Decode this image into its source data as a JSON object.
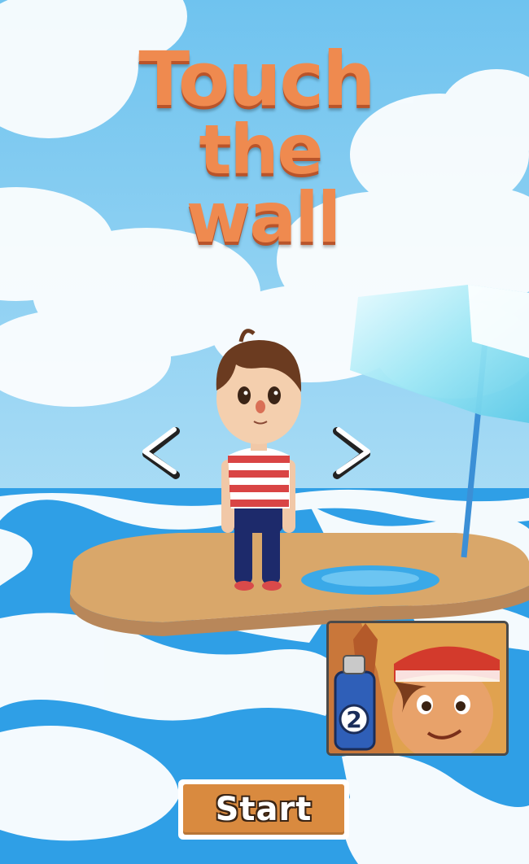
{
  "title": {
    "line1": "Touch",
    "line2": "the",
    "line3": "wall"
  },
  "character_select": {
    "prev_icon": "chevron-left-icon",
    "next_icon": "chevron-right-icon"
  },
  "ad": {
    "icon": "subway-surfers-2-thumbnail",
    "badge": "2"
  },
  "start_button": {
    "label": "Start"
  },
  "colors": {
    "title": "#ef8a4f",
    "title_shadow": "#b9542a",
    "start_button": "#d98a3f",
    "sky": "#7cc8ee",
    "water": "#2f9fe6",
    "sand": "#d9a76a"
  }
}
